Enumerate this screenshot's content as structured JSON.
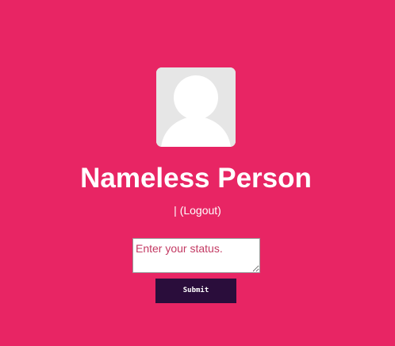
{
  "profile": {
    "name": "Nameless Person",
    "avatar_icon": "default-user-avatar-icon"
  },
  "user_links": {
    "separator": "|",
    "logout_label": "(Logout)"
  },
  "status_form": {
    "placeholder": "Enter your status.",
    "value": "",
    "submit_label": "Submit"
  },
  "colors": {
    "background": "#e82564",
    "button": "#2a0d3b",
    "avatar_background": "#e6e6e6",
    "text": "#ffffff",
    "placeholder_text": "#c33a63"
  }
}
